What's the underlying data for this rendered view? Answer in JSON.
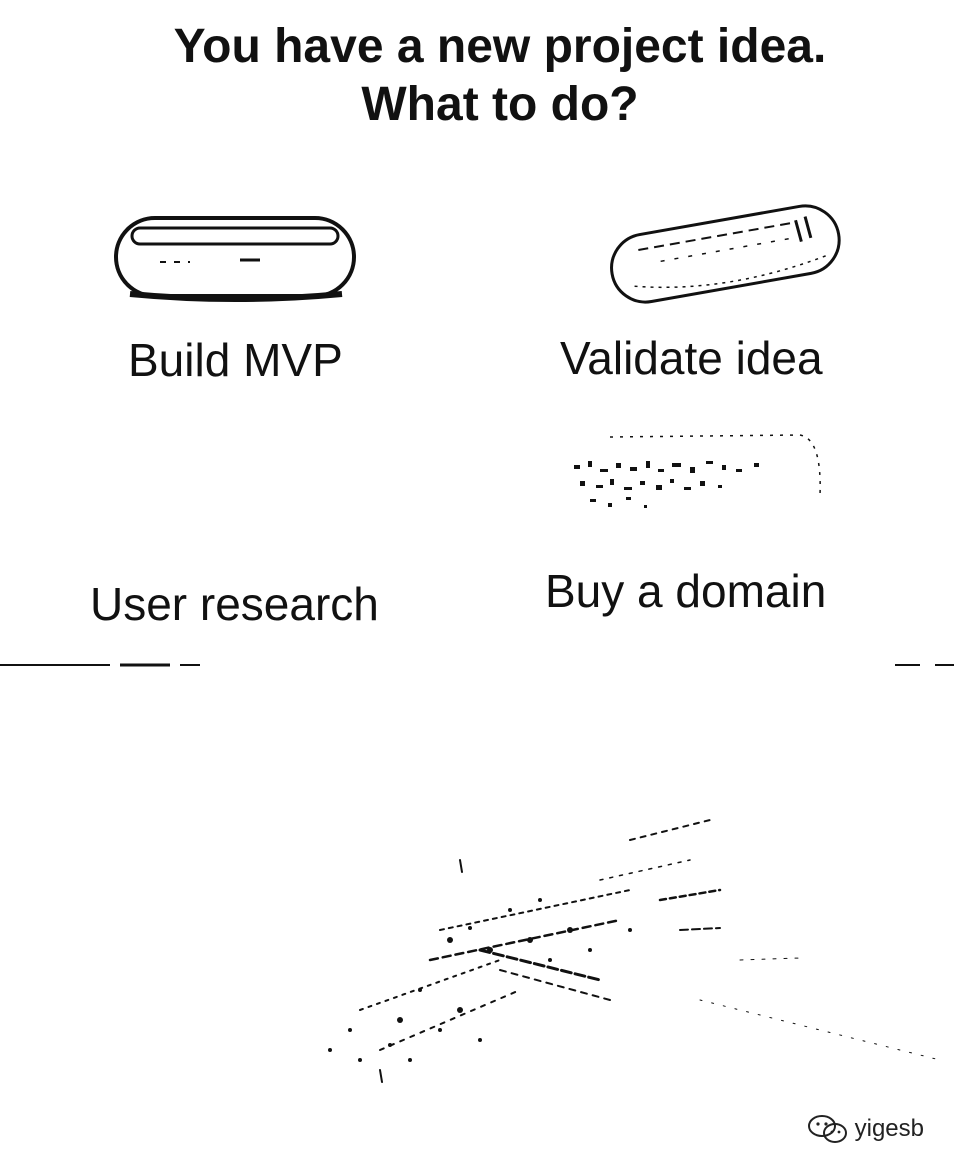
{
  "title": "You have a new project idea. What to do?",
  "options": [
    {
      "label": "Build MVP",
      "icon": "pill-icon"
    },
    {
      "label": "Validate idea",
      "icon": "pill-icon"
    },
    {
      "label": "User research",
      "icon": "none"
    },
    {
      "label": "Buy a domain",
      "icon": "pill-icon-faded"
    }
  ],
  "image": {
    "icon": "hand-reaching-icon"
  },
  "watermark": {
    "text": "yigesb",
    "icon": "wechat-icon"
  },
  "colors": {
    "ink": "#111111",
    "background": "#ffffff"
  }
}
